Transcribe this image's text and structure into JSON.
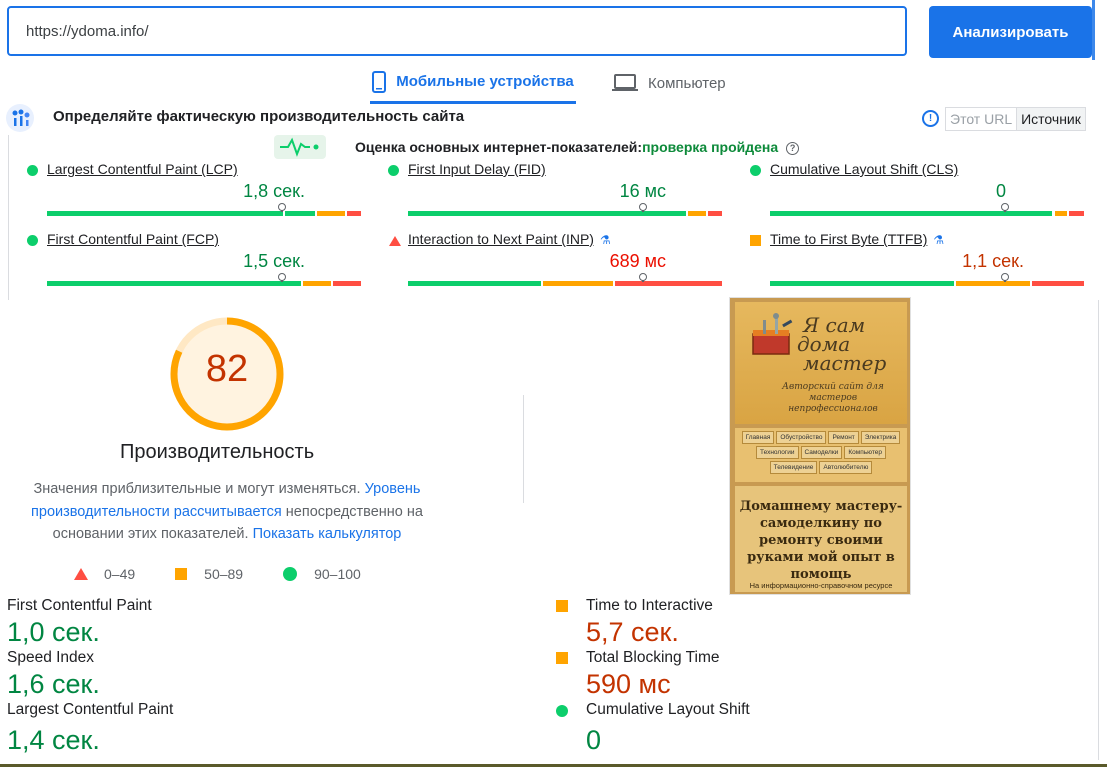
{
  "url_input": {
    "value": "https://ydoma.info/"
  },
  "analyze_label": "Анализировать",
  "tabs": {
    "mobile": "Мобильные устройства",
    "desktop": "Компьютер"
  },
  "field": {
    "title": "Определяйте фактическую производительность сайта",
    "toggle": {
      "url": "Этот URL",
      "origin": "Источник"
    },
    "assessment_prefix": "Оценка основных интернет-показателей:",
    "assessment_status": "проверка пройдена",
    "metrics": [
      {
        "label": "Largest Contentful Paint (LCP)",
        "value": "1,8 сек.",
        "rating": "good"
      },
      {
        "label": "First Input Delay (FID)",
        "value": "16 мс",
        "rating": "good"
      },
      {
        "label": "Cumulative Layout Shift (CLS)",
        "value": "0",
        "rating": "good"
      },
      {
        "label": "First Contentful Paint (FCP)",
        "value": "1,5 сек.",
        "rating": "good"
      },
      {
        "label": "Interaction to Next Paint (INP)",
        "value": "689 мс",
        "rating": "poor"
      },
      {
        "label": "Time to First Byte (TTFB)",
        "value": "1,1 сек.",
        "rating": "needs-improvement"
      }
    ]
  },
  "performance": {
    "score": "82",
    "title": "Производительность",
    "desc_part1": "Значения приблизительные и могут изменяться.",
    "desc_link1": "Уровень производительности рассчитывается",
    "desc_part2": "непосредственно на основании этих показателей.",
    "desc_link2": "Показать калькулятор",
    "legend": {
      "poor": "0–49",
      "average": "50–89",
      "good": "90–100"
    }
  },
  "thumbnail": {
    "brand_line1": "Я сам",
    "brand_line2": "дома",
    "brand_line3": "мастер",
    "subtitle": "Авторский сайт для мастеров непрофессионалов",
    "nav_row1": [
      "Главная",
      "Обустройство",
      "Ремонт",
      "Электрика"
    ],
    "nav_row2": [
      "Технологии",
      "Самоделки",
      "Компьютер"
    ],
    "nav_row3": [
      "Телевидение",
      "Автолюбителю"
    ],
    "headline": "Домашнему мастеру-самоделкину по ремонту своими руками мой опыт в помощь",
    "footer": "На информационно-справочном ресурсе"
  },
  "lab": [
    {
      "name": "First Contentful Paint",
      "value": "1,0 сек.",
      "rating": "good"
    },
    {
      "name": "Speed Index",
      "value": "1,6 сек.",
      "rating": "good"
    },
    {
      "name": "Largest Contentful Paint",
      "value": "1,4 сек.",
      "rating": "good"
    },
    {
      "name": "Time to Interactive",
      "value": "5,7 сек.",
      "rating": "average"
    },
    {
      "name": "Total Blocking Time",
      "value": "590 мс",
      "rating": "average"
    },
    {
      "name": "Cumulative Layout Shift",
      "value": "0",
      "rating": "good"
    }
  ],
  "colors": {
    "accent": "#1a73e8",
    "good": "#0cce6b",
    "average": "#ffa400",
    "poor": "#ff4e42"
  }
}
